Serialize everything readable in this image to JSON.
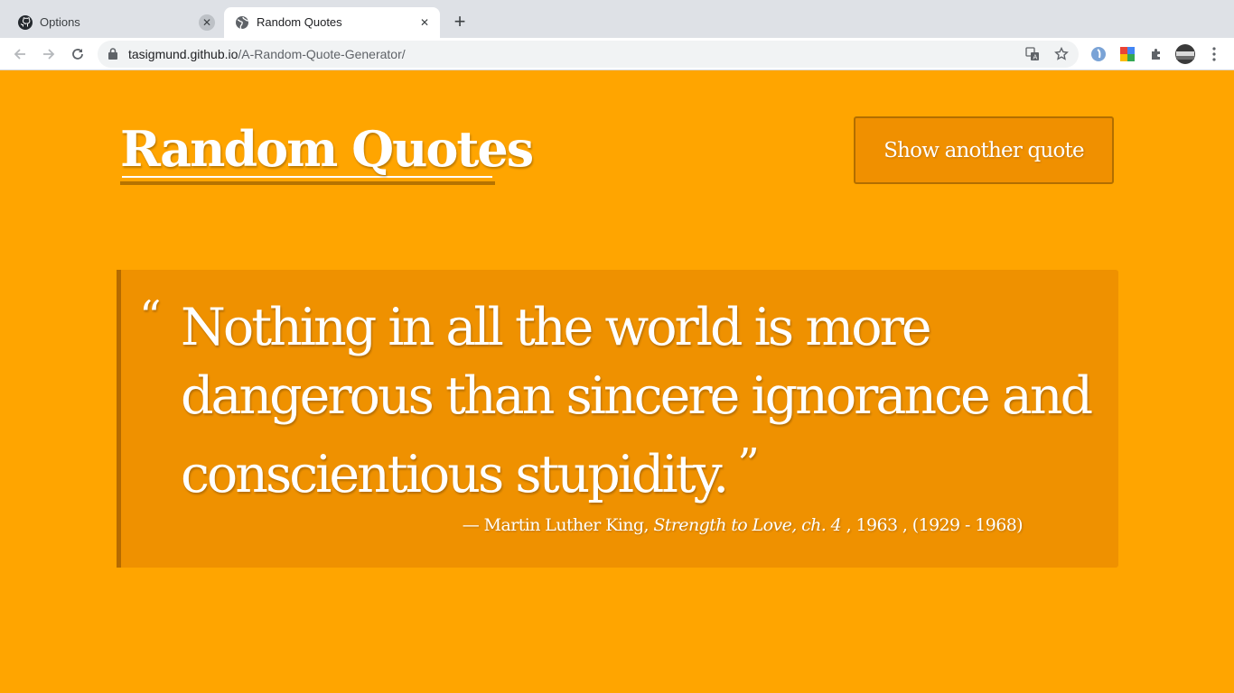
{
  "browser": {
    "tabs": [
      {
        "title": "Options",
        "icon": "github-icon",
        "active": false
      },
      {
        "title": "Random Quotes",
        "icon": "globe-icon",
        "active": true
      }
    ],
    "new_tab": "+",
    "url_host": "tasigmund.github.io",
    "url_path": "/A-Random-Quote-Generator/",
    "close_glyph": "✕"
  },
  "page": {
    "title": "Random Quotes",
    "button_label": "Show another quote",
    "quote": {
      "open_mark": "“",
      "text": "Nothing in all the world is more dangerous than sincere ignorance and conscientious stupidity.",
      "close_mark": "”",
      "dash": "—",
      "author": "Martin Luther King,",
      "source": "Strength to Love, ch. 4",
      "year": ", 1963 ,",
      "lifespan": "(1929 - 1968)"
    }
  },
  "colors": {
    "background": "#ffa500",
    "quote_box": "#ef9100",
    "accent_border": "#b56b00"
  }
}
